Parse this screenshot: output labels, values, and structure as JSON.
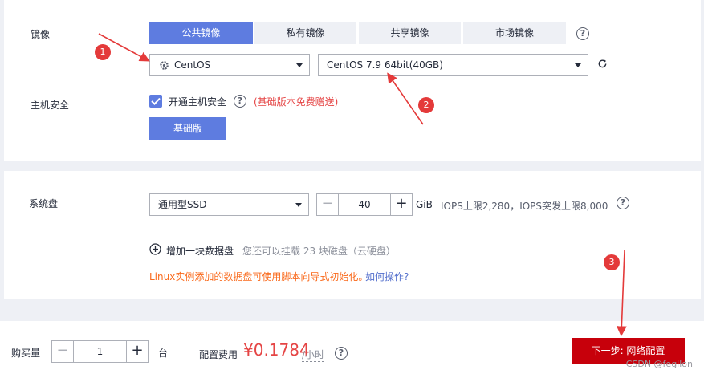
{
  "image_section": {
    "label": "镜像",
    "tabs": [
      {
        "label": "公共镜像",
        "active": true
      },
      {
        "label": "私有镜像",
        "active": false
      },
      {
        "label": "共享镜像",
        "active": false
      },
      {
        "label": "市场镜像",
        "active": false
      }
    ],
    "os_select": {
      "value": "CentOS",
      "icon": "gear-icon"
    },
    "version_select": {
      "value": "CentOS 7.9 64bit(40GB)"
    },
    "help_symbol": "?",
    "refresh_icon": "refresh-icon"
  },
  "host_security": {
    "label": "主机安全",
    "checkbox_label": "开通主机安全",
    "checked": true,
    "note": "(基础版本免费赠送)",
    "edition_button": "基础版"
  },
  "system_disk": {
    "label": "系统盘",
    "type_select": "通用型SSD",
    "size_value": "40",
    "unit": "GiB",
    "iops_text": "IOPS上限2,280，IOPS突发上限8,000",
    "add_disk_label": "增加一块数据盘",
    "add_disk_hint": "您还可以挂载 23 块磁盘（云硬盘）",
    "notice_text": "Linux实例添加的数据盘可使用脚本向导式初始化。",
    "notice_link": "如何操作?"
  },
  "footer": {
    "quantity_label": "购买量",
    "quantity_value": "1",
    "quantity_unit": "台",
    "fee_label": "配置费用",
    "price": "¥0.1784",
    "price_unit": "/小时",
    "next_button": "下一步: 网络配置"
  },
  "annotations": [
    "1",
    "2",
    "3"
  ],
  "watermark": "CSDN @fegllon",
  "colors": {
    "primary": "#5e7ce0",
    "danger": "#c7000b",
    "price": "#e54545",
    "annotation": "#e43a3a"
  }
}
